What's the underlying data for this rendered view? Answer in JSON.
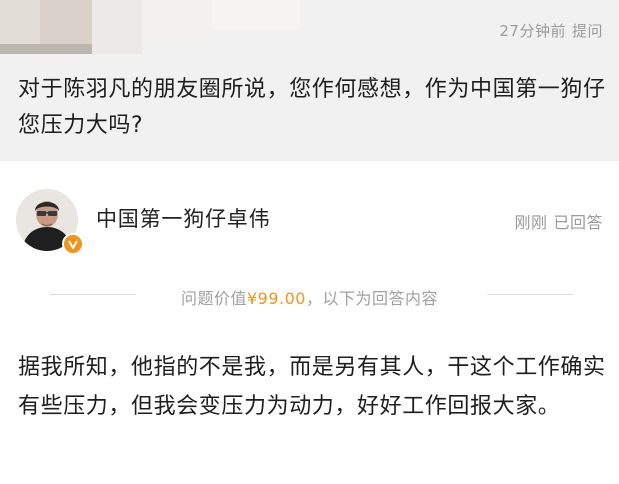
{
  "question": {
    "time": "27分钟前",
    "action": "提问",
    "text": "对于陈羽凡的朋友圈所说，您作何感想，作为中国第一狗仔您压力大吗?"
  },
  "answerer": {
    "name": "中国第一狗仔卓伟",
    "time": "刚刚",
    "status": "已回答",
    "badge_icon": "verified-v-icon",
    "badge_color": "#f0941d"
  },
  "price_divider": {
    "prefix": "问题价值",
    "price": "¥99.00",
    "suffix": "，以下为回答内容"
  },
  "answer": {
    "text": "据我所知，他指的不是我，而是另有其人，干这个工作确实有些压力，但我会变压力为动力，好好工作回报大家。"
  },
  "colors": {
    "accent": "#f0941d",
    "question_bg": "#f1f1f1",
    "meta_text": "#9a9a9a"
  }
}
